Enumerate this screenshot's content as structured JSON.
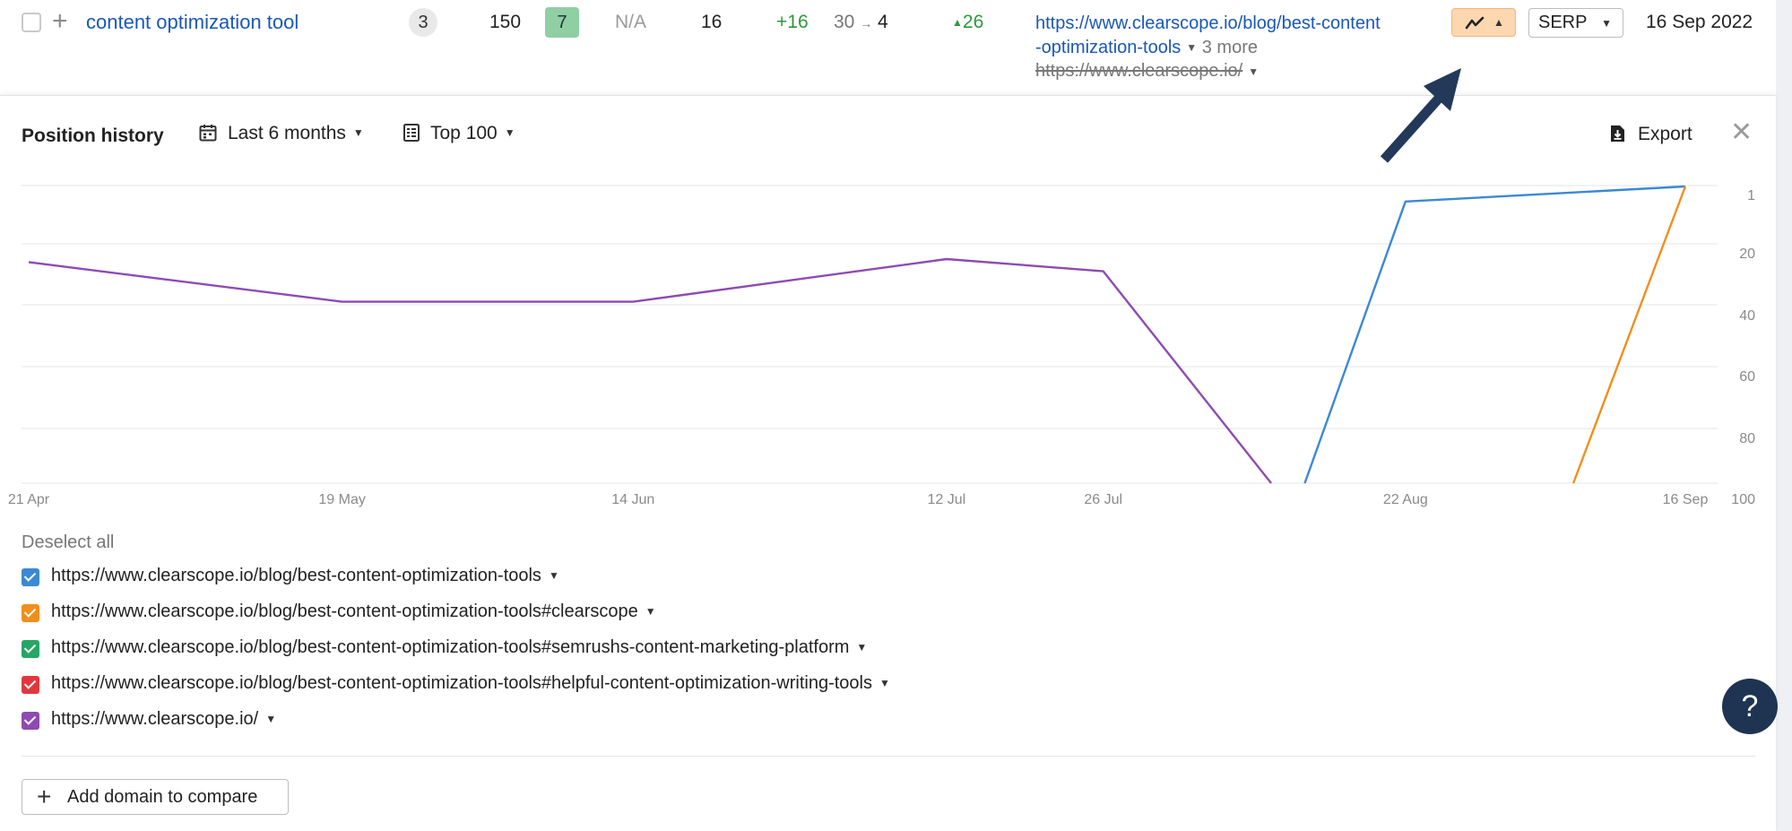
{
  "row": {
    "keyword": "content optimization tool",
    "serp_features_count": "3",
    "volume": "150",
    "kd": "7",
    "cpc": "N/A",
    "position": "16",
    "position_change": "+16",
    "position_from": "30",
    "position_to": "4",
    "traffic_change": "26",
    "url_line1": "https://www.clearscope.io/blog/best-content",
    "url_line2": "-optimization-tools",
    "more_text": "3 more",
    "old_url": "https://www.clearscope.io/",
    "serp_label": "SERP",
    "date": "16 Sep 2022"
  },
  "panel": {
    "title": "Position history",
    "period_label": "Last 6 months",
    "top_label": "Top 100",
    "export_label": "Export",
    "deselect_label": "Deselect all",
    "add_domain_label": "Add domain to compare",
    "help_label": "?"
  },
  "series_list": [
    {
      "label": "https://www.clearscope.io/blog/best-content-optimization-tools",
      "color": "#3a89d4"
    },
    {
      "label": "https://www.clearscope.io/blog/best-content-optimization-tools#clearscope",
      "color": "#f28e1c"
    },
    {
      "label": "https://www.clearscope.io/blog/best-content-optimization-tools#semrushs-content-marketing-platform",
      "color": "#27a567"
    },
    {
      "label": "https://www.clearscope.io/blog/best-content-optimization-tools#helpful-content-optimization-writing-tools",
      "color": "#e0383e"
    },
    {
      "label": "https://www.clearscope.io/",
      "color": "#8e4bb0"
    }
  ],
  "chart_data": {
    "type": "line",
    "x_ticks": [
      "21 Apr",
      "19 May",
      "14 Jun",
      "12 Jul",
      "26 Jul",
      "22 Aug",
      "16 Sep"
    ],
    "y_ticks": [
      1,
      20,
      40,
      60,
      80,
      100
    ],
    "y_reversed": true,
    "ylim": [
      1,
      100
    ],
    "series": [
      {
        "color": "#8e4bb0",
        "x": [
          "21 Apr",
          "19 May",
          "14 Jun",
          "12 Jul",
          "26 Jul",
          "10 Aug"
        ],
        "y": [
          26,
          39,
          39,
          25,
          29,
          100
        ]
      },
      {
        "color": "#3a89d4",
        "x": [
          "13 Aug",
          "22 Aug",
          "16 Sep"
        ],
        "y": [
          100,
          6,
          1
        ]
      },
      {
        "color": "#f28e1c",
        "x": [
          "6 Sep",
          "16 Sep"
        ],
        "y": [
          100,
          1
        ]
      }
    ],
    "grid": true
  }
}
